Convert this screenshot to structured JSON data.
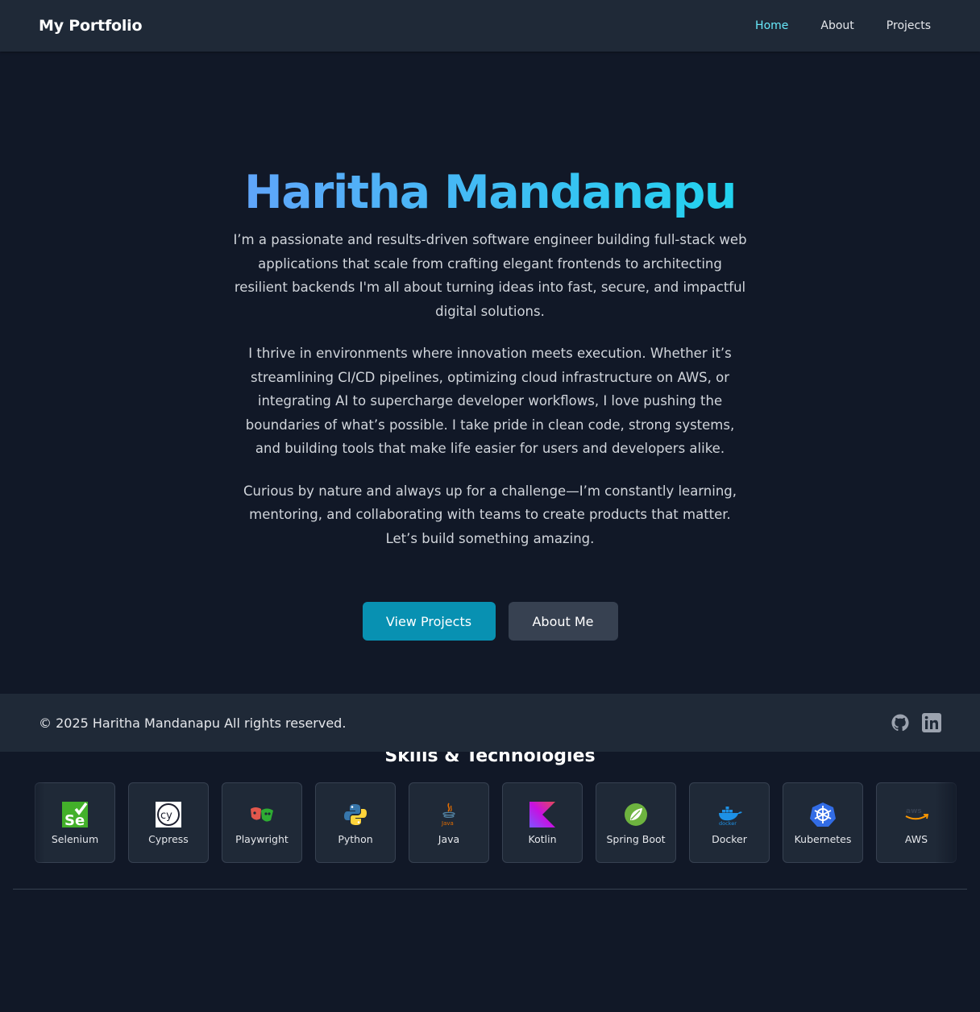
{
  "nav": {
    "brand": "My Portfolio",
    "links": [
      {
        "label": "Home",
        "active": true
      },
      {
        "label": "About",
        "active": false
      },
      {
        "label": "Projects",
        "active": false
      }
    ]
  },
  "hero": {
    "name": "Haritha Mandanapu",
    "paragraphs": [
      "I’m a passionate and results-driven software engineer building full-stack web applications that scale from crafting elegant frontends to architecting resilient backends I'm all about turning ideas into fast, secure, and impactful digital solutions.",
      "I thrive in environments where innovation meets execution. Whether it’s streamlining CI/CD pipelines, optimizing cloud infrastructure on AWS, or integrating AI to supercharge developer workflows, I love pushing the boundaries of what’s possible. I take pride in clean code, strong systems, and building tools that make life easier for users and developers alike.",
      "Curious by nature and always up for a challenge—I’m constantly learning, mentoring, and collaborating with teams to create products that matter. Let’s build something amazing."
    ],
    "primary_button": "View Projects",
    "secondary_button": "About Me"
  },
  "footer": {
    "copyright": "© 2025 Haritha Mandanapu All rights reserved.",
    "social_icons": [
      "github-icon",
      "linkedin-icon"
    ]
  },
  "skills": {
    "title": "Skills & Technologies",
    "items": [
      {
        "label": "Selenium",
        "icon": "selenium-icon"
      },
      {
        "label": "Cypress",
        "icon": "cypress-icon"
      },
      {
        "label": "Playwright",
        "icon": "playwright-icon"
      },
      {
        "label": "Python",
        "icon": "python-icon"
      },
      {
        "label": "Java",
        "icon": "java-icon"
      },
      {
        "label": "Kotlin",
        "icon": "kotlin-icon"
      },
      {
        "label": "Spring Boot",
        "icon": "spring-boot-icon"
      },
      {
        "label": "Docker",
        "icon": "docker-icon"
      },
      {
        "label": "Kubernetes",
        "icon": "kubernetes-icon"
      },
      {
        "label": "AWS",
        "icon": "aws-icon"
      }
    ]
  },
  "colors": {
    "background": "#111827",
    "surface": "#1f2937",
    "accent": "#0891b2",
    "nav_active": "#67e8f9",
    "title_gradient": [
      "#60a5fa",
      "#22d3ee"
    ]
  }
}
